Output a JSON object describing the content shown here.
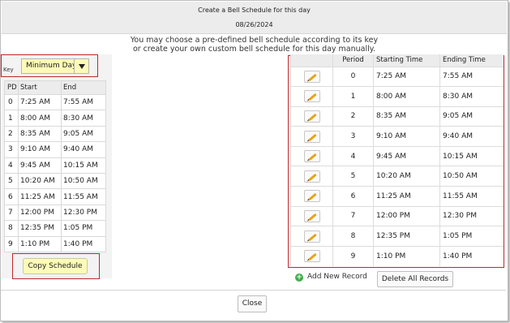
{
  "dialog": {
    "title": "Create a Bell Schedule for this day",
    "date": "08/26/2024",
    "instruction_line1": "You may choose a pre-defined bell schedule according to its key",
    "instruction_line2": "or create your own custom bell schedule for this day manually."
  },
  "key": {
    "label": "Key",
    "selected": "Minimum Day"
  },
  "preset_table": {
    "headers": [
      "PD",
      "Start",
      "End"
    ],
    "rows": [
      [
        "0",
        "7:25 AM",
        "7:55 AM"
      ],
      [
        "1",
        "8:00 AM",
        "8:30 AM"
      ],
      [
        "2",
        "8:35 AM",
        "9:05 AM"
      ],
      [
        "3",
        "9:10 AM",
        "9:40 AM"
      ],
      [
        "4",
        "9:45 AM",
        "10:15 AM"
      ],
      [
        "5",
        "10:20 AM",
        "10:50 AM"
      ],
      [
        "6",
        "11:25 AM",
        "11:55 AM"
      ],
      [
        "7",
        "12:00 PM",
        "12:30 PM"
      ],
      [
        "8",
        "12:35 PM",
        "1:05 PM"
      ],
      [
        "9",
        "1:10 PM",
        "1:40 PM"
      ]
    ]
  },
  "copy_button": "Copy Schedule",
  "schedule_table": {
    "headers": [
      "",
      "Period",
      "Starting Time",
      "Ending Time"
    ],
    "rows": [
      [
        "0",
        "7:25 AM",
        "7:55 AM"
      ],
      [
        "1",
        "8:00 AM",
        "8:30 AM"
      ],
      [
        "2",
        "8:35 AM",
        "9:05 AM"
      ],
      [
        "3",
        "9:10 AM",
        "9:40 AM"
      ],
      [
        "4",
        "9:45 AM",
        "10:15 AM"
      ],
      [
        "5",
        "10:20 AM",
        "10:50 AM"
      ],
      [
        "6",
        "11:25 AM",
        "11:55 AM"
      ],
      [
        "7",
        "12:00 PM",
        "12:30 PM"
      ],
      [
        "8",
        "12:35 PM",
        "1:05 PM"
      ],
      [
        "9",
        "1:10 PM",
        "1:40 PM"
      ]
    ]
  },
  "add_record": "Add New Record",
  "delete_all": "Delete All Records",
  "close": "Close",
  "icons": {
    "edit": "pencil-icon",
    "add": "plus-circle-icon",
    "dropdown": "chevron-down-icon"
  },
  "colors": {
    "highlight_border": "#c0272d",
    "yellow_field": "#fdfbb8",
    "add_green": "#3fae49",
    "pencil": "#e8a317"
  }
}
